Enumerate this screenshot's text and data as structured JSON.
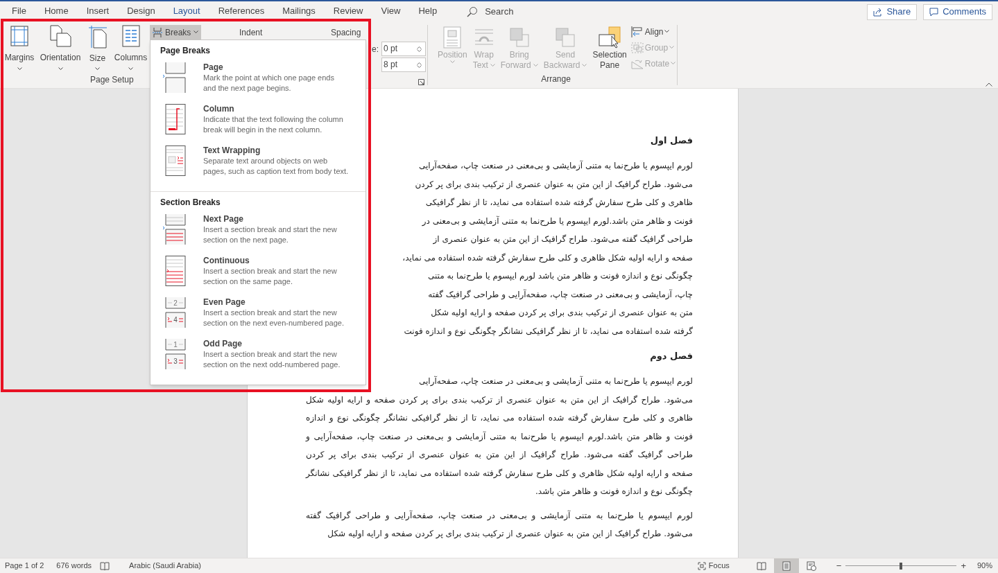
{
  "tabs": [
    {
      "label": "File",
      "selected": false
    },
    {
      "label": "Home",
      "selected": false
    },
    {
      "label": "Insert",
      "selected": false
    },
    {
      "label": "Design",
      "selected": false
    },
    {
      "label": "Layout",
      "selected": true
    },
    {
      "label": "References",
      "selected": false
    },
    {
      "label": "Mailings",
      "selected": false
    },
    {
      "label": "Review",
      "selected": false
    },
    {
      "label": "View",
      "selected": false
    },
    {
      "label": "Help",
      "selected": false
    }
  ],
  "search": {
    "placeholder": "Search"
  },
  "header_buttons": [
    {
      "label": "Share",
      "kind": "share"
    },
    {
      "label": "Comments",
      "kind": "comments"
    }
  ],
  "page_setup": {
    "label": "Page Setup",
    "buttons": [
      {
        "label": "Margins",
        "kind": "margins"
      },
      {
        "label": "Orientation",
        "kind": "orientation"
      },
      {
        "label": "Size",
        "kind": "size"
      },
      {
        "label": "Columns",
        "kind": "columns"
      }
    ],
    "breaks": {
      "label": "Breaks",
      "expanded": true
    }
  },
  "paragraph": {
    "indent_label": "Indent",
    "spacing_label": "Spacing",
    "fields": [
      {
        "label": "e:",
        "value": "0 pt"
      },
      {
        "value": "8 pt"
      }
    ]
  },
  "arrange": {
    "label": "Arrange",
    "large_buttons": [
      {
        "lines": [
          "Position"
        ],
        "kind": "position",
        "dropdown": true,
        "disabled": true
      },
      {
        "lines": [
          "Wrap",
          "Text"
        ],
        "kind": "wrap",
        "dropdown": true,
        "disabled": true
      },
      {
        "lines": [
          "Bring",
          "Forward"
        ],
        "kind": "bring",
        "dropdown": true,
        "disabled": true
      },
      {
        "lines": [
          "Send",
          "Backward"
        ],
        "kind": "send",
        "dropdown": true,
        "disabled": true
      },
      {
        "lines": [
          "Selection",
          "Pane"
        ],
        "kind": "selection",
        "dropdown": false,
        "disabled": false
      }
    ],
    "small_buttons": [
      {
        "label": "Align",
        "kind": "align",
        "disabled": false
      },
      {
        "label": "Group",
        "kind": "group",
        "disabled": true
      },
      {
        "label": "Rotate",
        "kind": "rotate",
        "disabled": true
      }
    ]
  },
  "breaks_menu": {
    "sections": [
      {
        "title": "Page Breaks",
        "items": [
          {
            "kind": "page",
            "title": "Page",
            "description_lines": [
              "Mark the point at which one page ends",
              "and the next page begins."
            ]
          },
          {
            "kind": "column",
            "title": "Column",
            "description_lines": [
              "Indicate that the text following the column",
              "break will begin in the next column."
            ]
          },
          {
            "kind": "text_wrapping",
            "title": "Text Wrapping",
            "description_lines": [
              "Separate text around objects on web",
              "pages, such as caption text from body text."
            ]
          }
        ]
      },
      {
        "title": "Section Breaks",
        "items": [
          {
            "kind": "next_page",
            "title": "Next Page",
            "description_lines": [
              "Insert a section break and start the new",
              "section on the next page."
            ]
          },
          {
            "kind": "continuous",
            "title": "Continuous",
            "description_lines": [
              "Insert a section break and start the new",
              "section on the same page."
            ]
          },
          {
            "kind": "even_page",
            "page_numbers": [
              "2",
              "4"
            ],
            "title": "Even Page",
            "description_lines": [
              "Insert a section break and start the new",
              "section on the next even-numbered page."
            ]
          },
          {
            "kind": "odd_page",
            "page_numbers": [
              "1",
              "3"
            ],
            "title": "Odd Page",
            "description_lines": [
              "Insert a section break and start the new",
              "section on the next odd-numbered page."
            ]
          }
        ]
      }
    ]
  },
  "document": {
    "sections": [
      {
        "heading": "فصل اول",
        "paragraphs": [
          {
            "lines": [
              {
                "text": "لورم ایپسوم یا طرح‌نما به متنی آزمایشی و بی‌معنی در صنعت چاپ، صفحه‌آرایی",
                "partial": true
              },
              {
                "text": "می‌شود. طراح گرافیک از این متن به عنوان عنصری از ترکیب بندی برای پر کردن",
                "partial": true
              },
              {
                "text": "ظاهری و کلی طرح سفارش گرفته شده استفاده می نماید، تا از نظر گرافیکی",
                "partial": true
              },
              {
                "text": "فونت و ظاهر متن باشد.لورم ایپسوم یا طرح‌نما به متنی آزمایشی و بی‌معنی در",
                "partial": true
              },
              {
                "text": "طراحی گرافیک گفته می‌شود. طراح گرافیک از این متن به عنوان عنصری از",
                "partial": true
              },
              {
                "text": "صفحه و ارایه اولیه شکل ظاهری و کلی طرح سفارش گرفته شده استفاده می نماید،",
                "partial": true
              },
              {
                "text": "چگونگی نوع و اندازه فونت و ظاهر متن باشد لورم ایپسوم یا طرح‌نما به متنی",
                "partial": true
              },
              {
                "text": "چاپ، آزمایشی و بی‌معنی در صنعت چاپ، صفحه‌آرایی و طراحی گرافیک گفته",
                "partial": true
              },
              {
                "text": "متن به عنوان عنصری از ترکیب بندی برای پر کردن صفحه و ارایه اولیه شکل",
                "partial": true
              },
              {
                "text": "گرفته شده استفاده می نماید، تا از نظر گرافیکی نشانگر چگونگی نوع و اندازه فونت"
              }
            ]
          }
        ]
      },
      {
        "heading": "فصل دوم",
        "paragraphs": [
          {
            "lines": [
              {
                "text": "لورم ایپسوم یا طرح‌نما به متنی آزمایشی و بی‌معنی در صنعت چاپ، صفحه‌آرایی",
                "partial": true
              },
              {
                "text": "می‌شود. طراح گرافیک از این متن به عنوان عنصری از ترکیب بندی برای پر کردن صفحه و ارایه اولیه شکل",
                "partial": false
              },
              {
                "text": "ظاهری و کلی طرح سفارش گرفته شده استفاده می نماید، تا از نظر گرافیکی نشانگر چگونگی نوع و اندازه",
                "partial": false
              },
              {
                "text": "فونت و ظاهر متن باشد.لورم ایپسوم یا طرح‌نما به متنی آزمایشی و بی‌معنی در صنعت چاپ، صفحه‌آرایی و",
                "partial": false
              },
              {
                "text": "طراحی گرافیک گفته می‌شود. طراح گرافیک از این متن به عنوان عنصری از ترکیب بندی برای پر کردن",
                "partial": false
              },
              {
                "text": "صفحه و ارایه اولیه شکل ظاهری و کلی طرح سفارش گرفته شده استفاده می نماید، تا از نظر گرافیکی نشانگر",
                "partial": false
              },
              {
                "text": "چگونگی نوع و اندازه فونت و ظاهر متن باشد."
              }
            ]
          },
          {
            "lines": [
              {
                "text": "لورم ایپسوم یا طرح‌نما به متنی آزمایشی و بی‌معنی در صنعت چاپ، صفحه‌آرایی و طراحی گرافیک گفته",
                "partial": false
              },
              {
                "text": "می‌شود. طراح گرافیک از این متن به عنوان عنصری از ترکیب بندی برای پر کردن صفحه و ارایه اولیه شکل"
              }
            ]
          }
        ]
      }
    ]
  },
  "status_bar": {
    "page": "Page 1 of 2",
    "words": "676 words",
    "language": "Arabic (Saudi Arabia)",
    "focus": "Focus",
    "views": [
      {
        "kind": "read",
        "selected": false
      },
      {
        "kind": "print",
        "selected": true
      },
      {
        "kind": "web",
        "selected": false
      }
    ],
    "zoom": {
      "minus": "−",
      "plus": "+",
      "level": 0.5,
      "reading": "90%"
    }
  }
}
